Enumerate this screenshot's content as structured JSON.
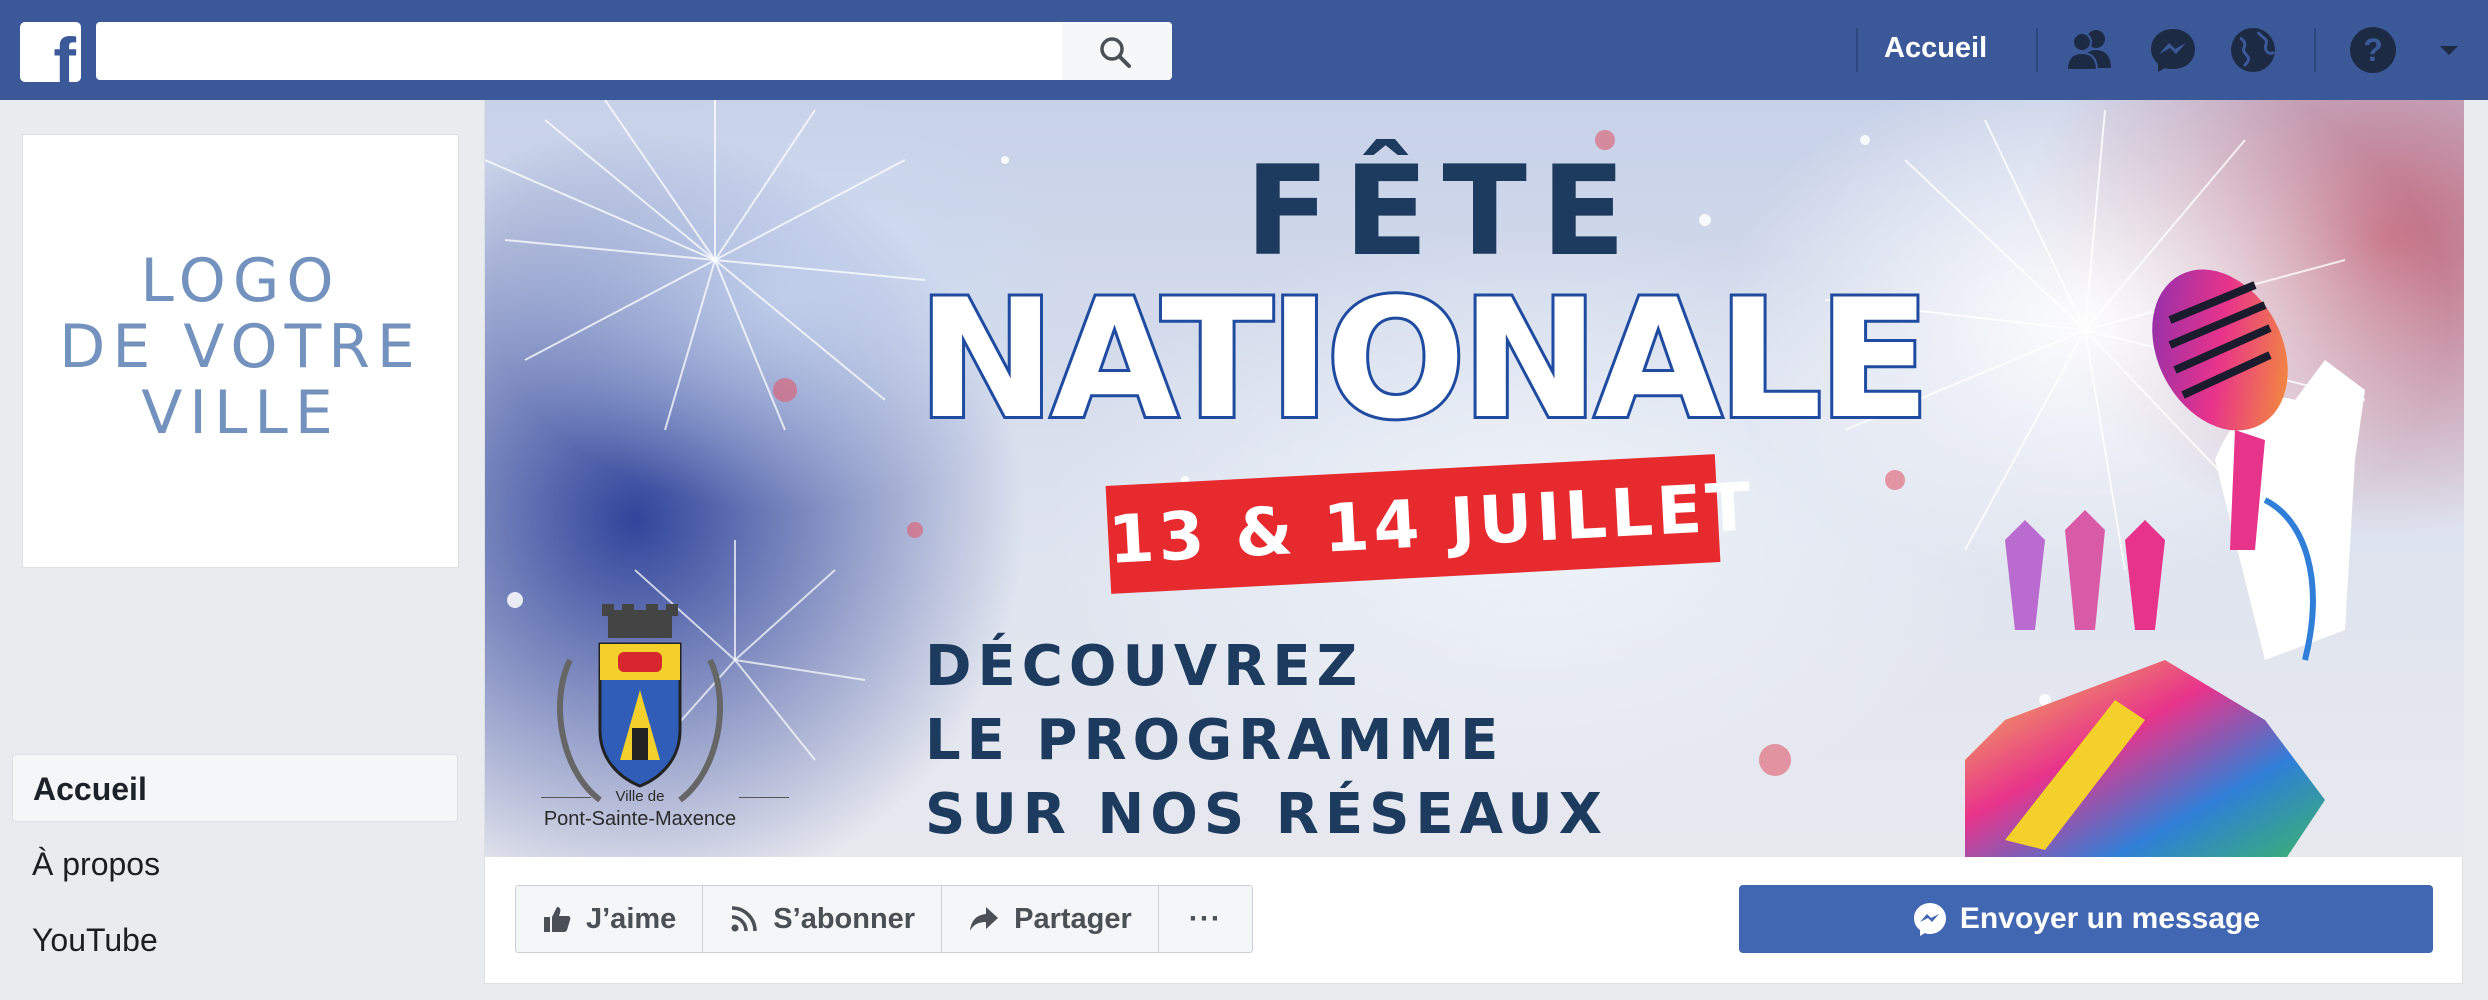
{
  "header": {
    "logo_letter": "f",
    "search": {
      "value": "",
      "placeholder": ""
    },
    "home_label": "Accueil",
    "icons": [
      "friends-icon",
      "messenger-icon",
      "globe-icon",
      "help-icon",
      "caret-down-icon"
    ]
  },
  "sidebar": {
    "logo_lines": [
      "LOGO",
      "DE VOTRE",
      "VILLE"
    ],
    "items": [
      {
        "label": "Accueil",
        "active": true
      },
      {
        "label": "À propos",
        "active": false
      },
      {
        "label": "YouTube",
        "active": false
      }
    ]
  },
  "cover": {
    "line1": "FÊTE",
    "line2": "NATIONALE",
    "date": "13 & 14 JUILLET",
    "discover_lines": [
      "DÉCOUVREZ",
      "LE PROGRAMME",
      "SUR NOS RÉSEAUX"
    ],
    "crest_small": "Ville de",
    "crest_name": "Pont-Sainte-Maxence"
  },
  "actions": {
    "like": "J’aime",
    "subscribe": "S’abonner",
    "share": "Partager",
    "more": "···",
    "message": "Envoyer un message"
  },
  "colors": {
    "brand": "#3b5998",
    "message_button": "#4267b2",
    "date_banner": "#e72a2d",
    "title_dark": "#1d3a5f"
  }
}
